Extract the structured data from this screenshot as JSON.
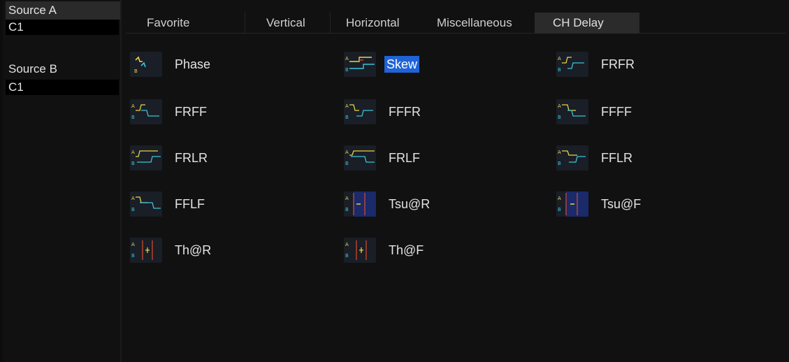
{
  "left_panel": {
    "source_a_label": "Source A",
    "source_a_value": "C1",
    "source_b_label": "Source B",
    "source_b_value": "C1"
  },
  "tabs": [
    {
      "label": "Favorite"
    },
    {
      "label": "Vertical"
    },
    {
      "label": "Horizontal"
    },
    {
      "label": "Miscellaneous"
    },
    {
      "label": "CH Delay"
    }
  ],
  "active_tab": "CH Delay",
  "measurements": [
    {
      "label": "Phase",
      "icon": "phase-icon",
      "selected": false
    },
    {
      "label": "Skew",
      "icon": "skew-icon",
      "selected": true
    },
    {
      "label": "FRFR",
      "icon": "frfr-icon",
      "selected": false
    },
    {
      "label": "FRFF",
      "icon": "frff-icon",
      "selected": false
    },
    {
      "label": "FFFR",
      "icon": "fffr-icon",
      "selected": false
    },
    {
      "label": "FFFF",
      "icon": "ffff-icon",
      "selected": false
    },
    {
      "label": "FRLR",
      "icon": "frlr-icon",
      "selected": false
    },
    {
      "label": "FRLF",
      "icon": "frlf-icon",
      "selected": false
    },
    {
      "label": "FFLR",
      "icon": "fflr-icon",
      "selected": false
    },
    {
      "label": "FFLF",
      "icon": "fflf-icon",
      "selected": false
    },
    {
      "label": "Tsu@R",
      "icon": "setup-rise-icon",
      "selected": false
    },
    {
      "label": "Tsu@F",
      "icon": "setup-fall-icon",
      "selected": false
    },
    {
      "label": "Th@R",
      "icon": "hold-rise-icon",
      "selected": false
    },
    {
      "label": "Th@F",
      "icon": "hold-fall-icon",
      "selected": false
    }
  ],
  "colors": {
    "ch_a": "#e8d44a",
    "ch_b": "#3cc4d8",
    "marker": "#e04a2a",
    "selected": "#1f63d6"
  }
}
